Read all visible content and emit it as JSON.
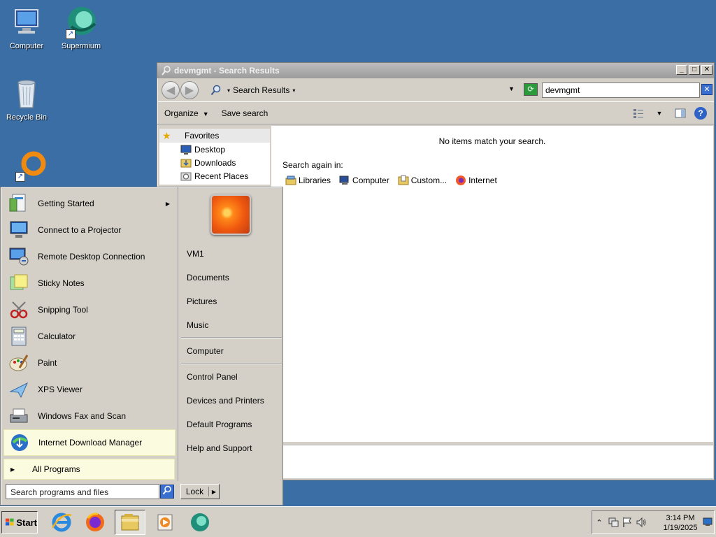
{
  "desktop": {
    "icons": [
      {
        "label": "Computer"
      },
      {
        "label": "Supermium"
      },
      {
        "label": "Recycle Bin"
      },
      {
        "label": ""
      }
    ]
  },
  "window": {
    "title": "devmgmt - Search Results",
    "minimize": "_",
    "maximize": "□",
    "close": "✕",
    "address": {
      "crumb": "Search Results"
    },
    "search_value": "devmgmt",
    "toolbar": {
      "organize": "Organize",
      "save_search": "Save search"
    },
    "nav": {
      "favorites": "Favorites",
      "items": [
        {
          "label": "Desktop"
        },
        {
          "label": "Downloads"
        },
        {
          "label": "Recent Places"
        }
      ]
    },
    "content": {
      "no_items": "No items match your search.",
      "search_again": "Search again in:",
      "locations": [
        {
          "label": "Libraries"
        },
        {
          "label": "Computer"
        },
        {
          "label": "Custom..."
        },
        {
          "label": "Internet"
        }
      ]
    }
  },
  "start_menu": {
    "programs": [
      {
        "label": "Getting Started"
      },
      {
        "label": "Connect to a Projector"
      },
      {
        "label": "Remote Desktop Connection"
      },
      {
        "label": "Sticky Notes"
      },
      {
        "label": "Snipping Tool"
      },
      {
        "label": "Calculator"
      },
      {
        "label": "Paint"
      },
      {
        "label": "XPS Viewer"
      },
      {
        "label": "Windows Fax and Scan"
      },
      {
        "label": "Internet Download Manager"
      }
    ],
    "all_programs": "All Programs",
    "right_links": [
      {
        "label": "VM1"
      },
      {
        "label": "Documents"
      },
      {
        "label": "Pictures"
      },
      {
        "label": "Music"
      },
      {
        "label": "Computer"
      },
      {
        "label": "Control Panel"
      },
      {
        "label": "Devices and Printers"
      },
      {
        "label": "Default Programs"
      },
      {
        "label": "Help and Support"
      }
    ],
    "search_placeholder": "Search programs and files",
    "lock_label": "Lock"
  },
  "taskbar": {
    "start_label": "Start",
    "clock_time": "3:14 PM",
    "clock_date": "1/19/2025"
  }
}
